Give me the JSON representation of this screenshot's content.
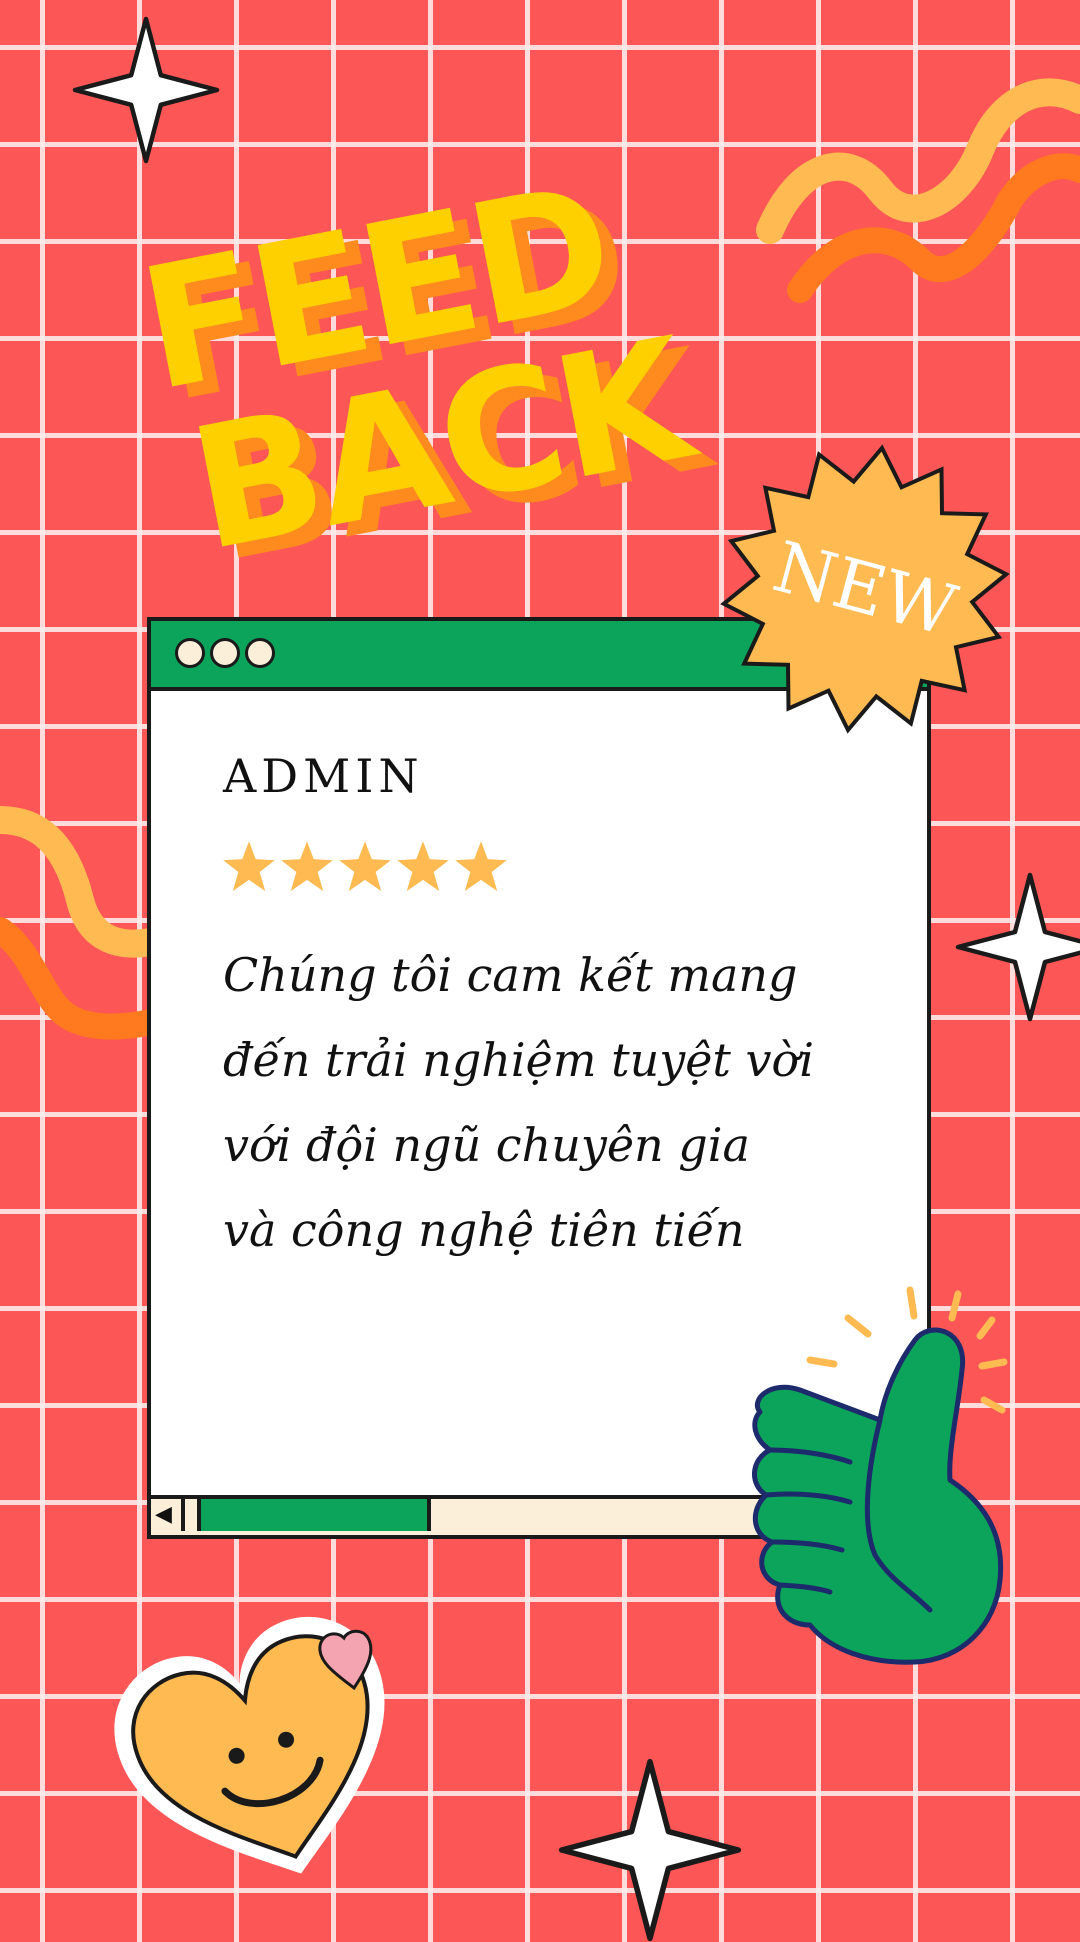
{
  "title": {
    "line1": "FEED",
    "line2": "BACK"
  },
  "badge": {
    "label": "NEW"
  },
  "review": {
    "author": "ADMIN",
    "rating": 5,
    "rating_max": 5,
    "lines": [
      "Chúng tôi cam kết mang",
      "đến trải nghiệm tuyệt vời",
      "với đội ngũ chuyên gia",
      "và công nghệ tiên tiến"
    ]
  },
  "scrollbar": {
    "left_arrow": "◀"
  },
  "colors": {
    "background": "#fd5656",
    "grid": "#ffebeb",
    "title_fill": "#ffd000",
    "title_shadow": "#ff8a1e",
    "window_green": "#0ba45a",
    "star": "#ffba52",
    "badge": "#ffba52",
    "heart": "#ffba52",
    "heart_small": "#f4a3b0"
  },
  "icons": {
    "window_dots": "three-dots-icon",
    "stars": "star-icon",
    "badge": "starburst-icon",
    "thumb": "thumbs-up-icon",
    "heart": "smiling-heart-icon",
    "sparkles": "sparkle-icon"
  }
}
